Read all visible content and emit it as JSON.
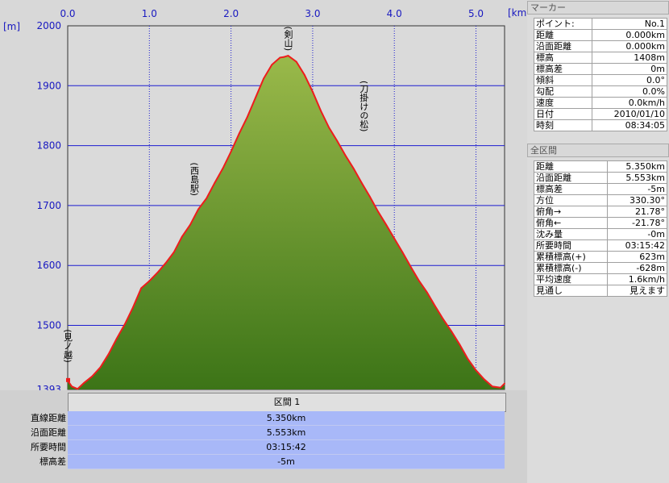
{
  "chart_data": {
    "type": "area",
    "x_unit": "[km]",
    "y_unit": "[m]",
    "xlim": [
      0,
      5.35
    ],
    "ylim": [
      1393,
      2000
    ],
    "x_ticks": [
      "0.0",
      "1.0",
      "2.0",
      "3.0",
      "4.0",
      "5.0"
    ],
    "y_ticks": [
      "2000",
      "1900",
      "1800",
      "1700",
      "1600",
      "1500",
      "1393"
    ],
    "profile": [
      [
        0.0,
        1408
      ],
      [
        0.05,
        1398
      ],
      [
        0.12,
        1394
      ],
      [
        0.2,
        1404
      ],
      [
        0.3,
        1415
      ],
      [
        0.4,
        1430
      ],
      [
        0.5,
        1452
      ],
      [
        0.6,
        1478
      ],
      [
        0.7,
        1502
      ],
      [
        0.8,
        1530
      ],
      [
        0.9,
        1562
      ],
      [
        1.0,
        1574
      ],
      [
        1.1,
        1588
      ],
      [
        1.2,
        1604
      ],
      [
        1.3,
        1622
      ],
      [
        1.4,
        1648
      ],
      [
        1.5,
        1668
      ],
      [
        1.6,
        1694
      ],
      [
        1.7,
        1712
      ],
      [
        1.8,
        1738
      ],
      [
        1.9,
        1762
      ],
      [
        2.0,
        1790
      ],
      [
        2.1,
        1820
      ],
      [
        2.2,
        1848
      ],
      [
        2.3,
        1880
      ],
      [
        2.4,
        1912
      ],
      [
        2.5,
        1935
      ],
      [
        2.6,
        1947
      ],
      [
        2.65,
        1948
      ],
      [
        2.7,
        1950
      ],
      [
        2.8,
        1940
      ],
      [
        2.9,
        1918
      ],
      [
        3.0,
        1890
      ],
      [
        3.1,
        1858
      ],
      [
        3.2,
        1830
      ],
      [
        3.3,
        1808
      ],
      [
        3.4,
        1784
      ],
      [
        3.5,
        1762
      ],
      [
        3.6,
        1738
      ],
      [
        3.7,
        1715
      ],
      [
        3.8,
        1690
      ],
      [
        3.9,
        1668
      ],
      [
        4.0,
        1645
      ],
      [
        4.1,
        1622
      ],
      [
        4.2,
        1598
      ],
      [
        4.3,
        1575
      ],
      [
        4.4,
        1555
      ],
      [
        4.5,
        1532
      ],
      [
        4.6,
        1510
      ],
      [
        4.7,
        1490
      ],
      [
        4.8,
        1468
      ],
      [
        4.9,
        1444
      ],
      [
        5.0,
        1425
      ],
      [
        5.1,
        1410
      ],
      [
        5.2,
        1398
      ],
      [
        5.3,
        1396
      ],
      [
        5.35,
        1403
      ]
    ],
    "waypoints": [
      {
        "x": 0.0,
        "y": 1408,
        "label": "(見ノ越)"
      },
      {
        "x": 1.55,
        "y": 1708,
        "label": "(西島駅)"
      },
      {
        "x": 2.7,
        "y": 1950,
        "label": "(剣山)"
      },
      {
        "x": 3.35,
        "y": 1815,
        "label": "(刀掛けの松)"
      }
    ],
    "colors": {
      "fill_top": "#9ab94a",
      "fill_bottom": "#3c7417",
      "line": "#ee1c1c",
      "grid": "#1c1cd0",
      "plot_bg": "#dadada"
    }
  },
  "summary": {
    "header": "区間 1",
    "rows": [
      {
        "label": "直線距離",
        "value": "5.350km"
      },
      {
        "label": "沿面距離",
        "value": "5.553km"
      },
      {
        "label": "所要時間",
        "value": "03:15:42"
      },
      {
        "label": "標高差",
        "value": "-5m"
      }
    ]
  },
  "marker": {
    "title": "マーカー",
    "rows": [
      {
        "label": "ポイント:",
        "value": "No.1"
      },
      {
        "label": "距離",
        "value": "0.000km"
      },
      {
        "label": "沿面距離",
        "value": "0.000km"
      },
      {
        "label": "標高",
        "value": "1408m"
      },
      {
        "label": "標高差",
        "value": "0m"
      },
      {
        "label": "傾斜",
        "value": "0.0°"
      },
      {
        "label": "勾配",
        "value": "0.0%"
      },
      {
        "label": "速度",
        "value": "0.0km/h"
      },
      {
        "label": "日付",
        "value": "2010/01/10"
      },
      {
        "label": "時刻",
        "value": "08:34:05"
      }
    ]
  },
  "section": {
    "title": "全区間",
    "rows": [
      {
        "label": "距離",
        "value": "5.350km"
      },
      {
        "label": "沿面距離",
        "value": "5.553km"
      },
      {
        "label": "標高差",
        "value": "-5m"
      },
      {
        "label": "方位",
        "value": "330.30°"
      },
      {
        "label": "俯角→",
        "value": "21.78°"
      },
      {
        "label": "俯角←",
        "value": "-21.78°"
      },
      {
        "label": "沈み量",
        "value": "-0m"
      },
      {
        "label": "所要時間",
        "value": "03:15:42"
      },
      {
        "label": "累積標高(+)",
        "value": "623m"
      },
      {
        "label": "累積標高(-)",
        "value": "-628m"
      },
      {
        "label": "平均速度",
        "value": "1.6km/h"
      },
      {
        "label": "見通し",
        "value": "見えます"
      }
    ]
  }
}
